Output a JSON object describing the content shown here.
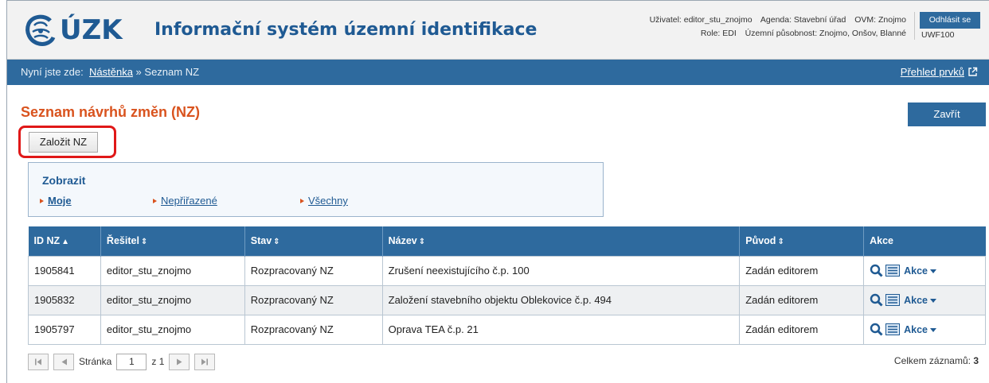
{
  "header": {
    "logo_text": "ÚZK",
    "title": "Informační systém územní identifikace",
    "user_line1": [
      "Uživatel: editor_stu_znojmo",
      "Agenda: Stavební úřad",
      "OVM: Znojmo"
    ],
    "user_line2": [
      "Role: EDI",
      "Územní působnost: Znojmo, Onšov, Blanné"
    ],
    "logout_label": "Odhlásit se",
    "system_code": "UWF100"
  },
  "breadcrumb": {
    "prefix": "Nyní jste zde:",
    "link": "Nástěnka",
    "separator": "»",
    "current": "Seznam NZ",
    "overview_link": "Přehled prvků"
  },
  "page": {
    "title": "Seznam návrhů změn (NZ)",
    "close_label": "Zavřít",
    "new_label": "Založit NZ"
  },
  "filter": {
    "title": "Zobrazit",
    "options": [
      "Moje",
      "Nepřiřazené",
      "Všechny"
    ],
    "active": "Moje"
  },
  "table": {
    "columns": [
      "ID NZ",
      "Řešitel",
      "Stav",
      "Název",
      "Původ",
      "Akce"
    ],
    "sort_asc": "▲",
    "sort_both": "⇕",
    "rows": [
      {
        "id": "1905841",
        "resitel": "editor_stu_znojmo",
        "stav": "Rozpracovaný NZ",
        "nazev": "Zrušení neexistujícího č.p. 100",
        "puvod": "Zadán editorem",
        "akce": "Akce"
      },
      {
        "id": "1905832",
        "resitel": "editor_stu_znojmo",
        "stav": "Rozpracovaný NZ",
        "nazev": "Založení stavebního objektu Oblekovice č.p. 494",
        "puvod": "Zadán editorem",
        "akce": "Akce"
      },
      {
        "id": "1905797",
        "resitel": "editor_stu_znojmo",
        "stav": "Rozpracovaný NZ",
        "nazev": "Oprava TEA č.p. 21",
        "puvod": "Zadán editorem",
        "akce": "Akce"
      }
    ]
  },
  "pager": {
    "page_label": "Stránka",
    "page_value": "1",
    "of_label": "z 1",
    "total_label": "Celkem záznamů:",
    "total_value": "3"
  },
  "colors": {
    "accent": "#2e6a9e",
    "title_orange": "#d9531e",
    "highlight_red": "#e01818"
  }
}
